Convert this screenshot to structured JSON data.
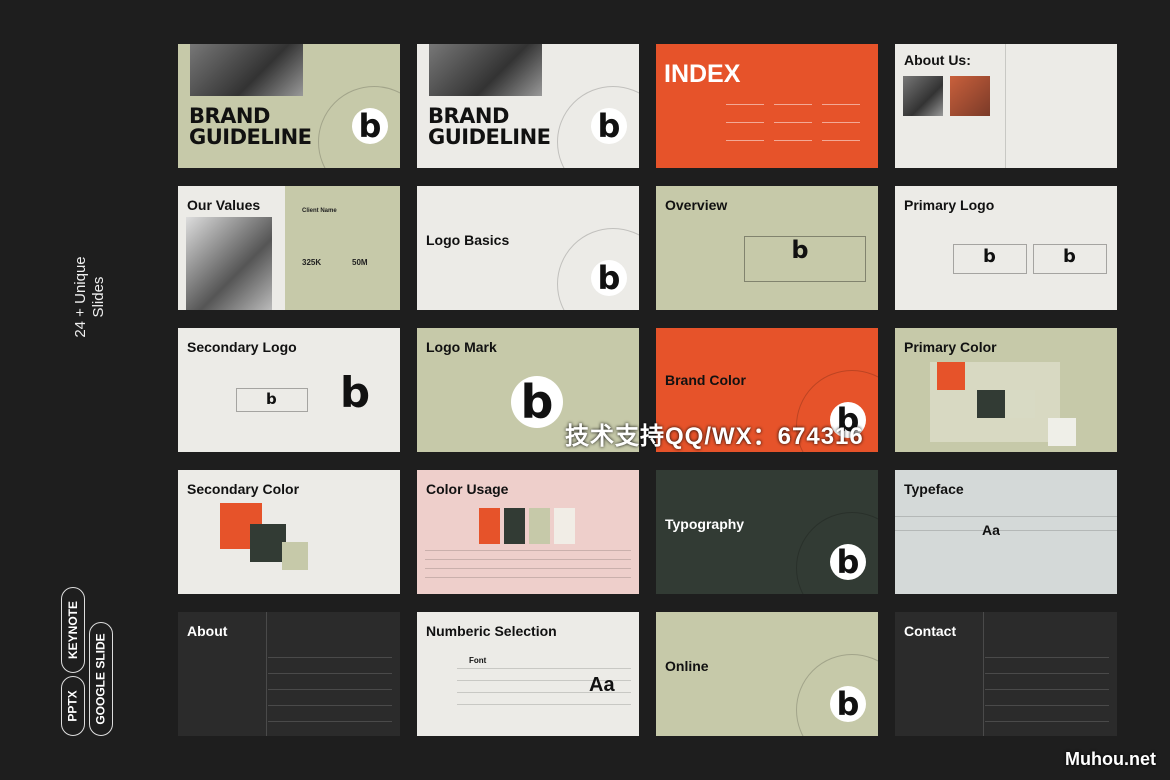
{
  "sidebar": {
    "headline_line1": "24 + Unique",
    "headline_line2": "Slides",
    "formats": [
      "PPTX",
      "KEYNOTE",
      "GOOGLE SLIDE"
    ]
  },
  "colors": {
    "background": "#1e1e1e",
    "sage": "#c6c9a9",
    "light": "#ecebe7",
    "orange": "#e6532a",
    "dark_green": "#323b34",
    "pink": "#eecfcb",
    "grey_blue": "#d4d9d8",
    "dark": "#2b2b2b"
  },
  "slides": [
    {
      "title": "BRAND GUIDELINE",
      "bg": "#c6c9a9",
      "fg": "#111",
      "kind": "cover"
    },
    {
      "title": "BRAND GUIDELINE",
      "bg": "#ecebe7",
      "fg": "#111",
      "kind": "cover"
    },
    {
      "title": "INDEX",
      "bg": "#e6532a",
      "fg": "#fff",
      "kind": "index"
    },
    {
      "title": "About Us:",
      "bg": "#ecebe7",
      "fg": "#111",
      "kind": "about"
    },
    {
      "title": "Our Values",
      "bg": "#ecebe7",
      "fg": "#111",
      "kind": "values",
      "stats": [
        "325K",
        "50M"
      ],
      "label": "Client Name"
    },
    {
      "title": "Logo Basics",
      "bg": "#ecebe7",
      "fg": "#111",
      "kind": "midlogo"
    },
    {
      "title": "Overview",
      "bg": "#c6c9a9",
      "fg": "#111",
      "kind": "frame"
    },
    {
      "title": "Primary Logo",
      "bg": "#ecebe7",
      "fg": "#111",
      "kind": "twologo"
    },
    {
      "title": "Secondary Logo",
      "bg": "#ecebe7",
      "fg": "#111",
      "kind": "seclogo"
    },
    {
      "title": "Logo Mark",
      "bg": "#c6c9a9",
      "fg": "#111",
      "kind": "mark"
    },
    {
      "title": "Brand Color",
      "bg": "#e6532a",
      "fg": "#111",
      "kind": "midlogo"
    },
    {
      "title": "Primary Color",
      "bg": "#c6c9a9",
      "fg": "#111",
      "kind": "pcolor"
    },
    {
      "title": "Secondary Color",
      "bg": "#ecebe7",
      "fg": "#111",
      "kind": "scolor"
    },
    {
      "title": "Color Usage",
      "bg": "#eecfcb",
      "fg": "#111",
      "kind": "usage"
    },
    {
      "title": "Typography",
      "bg": "#323b34",
      "fg": "#fff",
      "kind": "midlogo"
    },
    {
      "title": "Typeface",
      "bg": "#d4d9d8",
      "fg": "#111",
      "kind": "typeface",
      "sample": "Aa"
    },
    {
      "title": "About",
      "bg": "#2b2b2b",
      "fg": "#fff",
      "kind": "table"
    },
    {
      "title": "Numberic Selection",
      "bg": "#ecebe7",
      "fg": "#111",
      "kind": "numeric",
      "sample": "Aa",
      "label": "Font"
    },
    {
      "title": "Online",
      "bg": "#c6c9a9",
      "fg": "#111",
      "kind": "midlogo"
    },
    {
      "title": "Contact",
      "bg": "#2b2b2b",
      "fg": "#fff",
      "kind": "table"
    }
  ],
  "watermark": "技术支持QQ/WX：674316",
  "site_watermark": "Muhou.net"
}
